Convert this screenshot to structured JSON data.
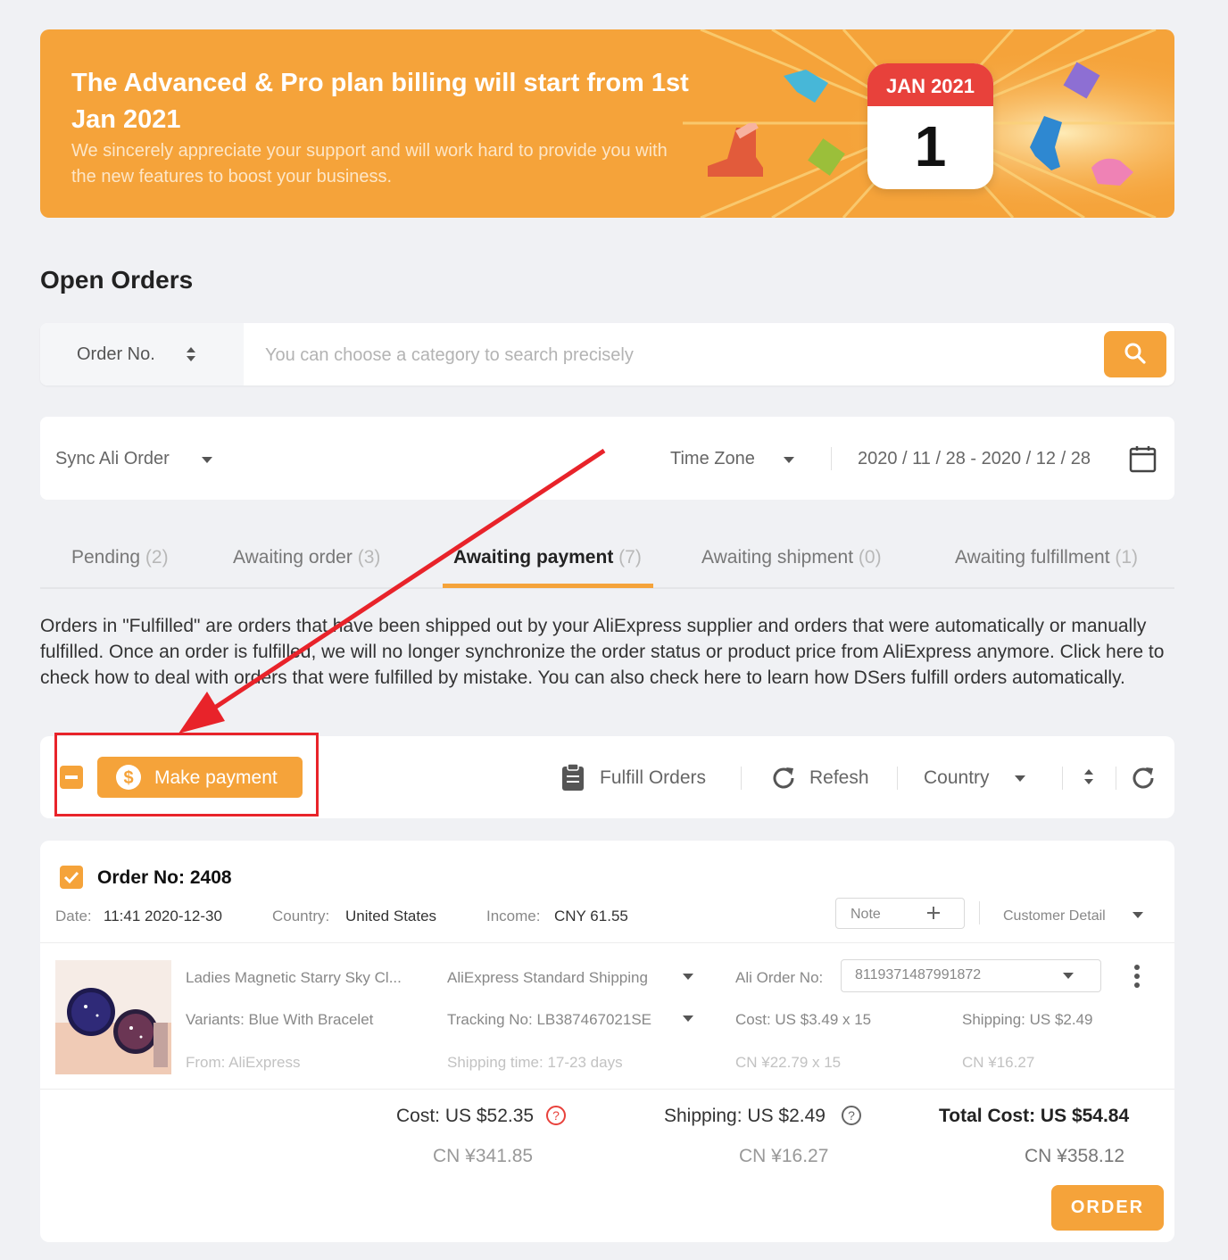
{
  "banner": {
    "title": "The Advanced & Pro plan billing will start from 1st Jan 2021",
    "subtitle": "We sincerely appreciate your support and will work hard to provide you with the new features to boost your business.",
    "calendar_month": "JAN 2021",
    "calendar_day": "1"
  },
  "page_title": "Open Orders",
  "search": {
    "category": "Order No.",
    "placeholder": "You can choose a category to search precisely"
  },
  "filters": {
    "sync": "Sync Ali Order",
    "timezone": "Time Zone",
    "date_range": "2020 / 11 / 28 - 2020 / 12 / 28"
  },
  "tabs": [
    {
      "label": "Pending",
      "count": "(2)"
    },
    {
      "label": "Awaiting order",
      "count": "(3)"
    },
    {
      "label": "Awaiting payment",
      "count": "(7)"
    },
    {
      "label": "Awaiting shipment",
      "count": "(0)"
    },
    {
      "label": "Awaiting fulfillment",
      "count": "(1)"
    }
  ],
  "active_tab": "Awaiting payment",
  "info_text": "Orders in \"Fulfilled\" are orders that have been shipped out by your AliExpress supplier and orders that were automatically or manually fulfilled. Once an order is fulfilled, we will no longer synchronize the order status or product price from AliExpress anymore. Click here to check how to deal with orders that were fulfilled by mistake. You can also check here to learn how DSers fulfill orders automatically.",
  "actions": {
    "make_payment": "Make payment",
    "fulfill": "Fulfill Orders",
    "refresh": "Refesh",
    "country": "Country"
  },
  "order": {
    "title": "Order No: 2408",
    "date_label": "Date:",
    "date_value": "11:41 2020-12-30",
    "country_label": "Country:",
    "country_value": "United States",
    "income_label": "Income:",
    "income_value": "CNY 61.55",
    "note": "Note",
    "customer_detail": "Customer Detail",
    "product": {
      "name": "Ladies Magnetic Starry Sky Cl...",
      "variants": "Variants: Blue With Bracelet",
      "from": "From: AliExpress",
      "shipping_method": "AliExpress Standard Shipping",
      "tracking": "Tracking No: LB387467021SE",
      "shipping_time": "Shipping time: 17-23 days",
      "ali_order_label": "Ali Order No:",
      "ali_order_value": "8119371487991872",
      "cost": "Cost: US $3.49 x 15",
      "cost_cny": "CN ¥22.79 x 15",
      "shipping": "Shipping: US $2.49",
      "shipping_cny": "CN ¥16.27"
    },
    "totals": {
      "cost": "Cost: US $52.35",
      "cost_cny": "CN ¥341.85",
      "shipping": "Shipping: US $2.49",
      "shipping_cny": "CN ¥16.27",
      "total": "Total Cost: US $54.84",
      "total_cny": "CN ¥358.12"
    },
    "order_button": "ORDER"
  },
  "colors": {
    "accent": "#f5a33a",
    "annotation_red": "#e8232a",
    "background": "#f0f1f4"
  }
}
